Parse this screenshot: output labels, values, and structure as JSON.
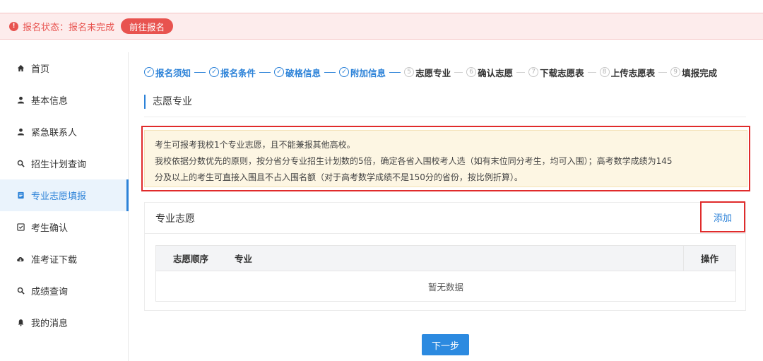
{
  "alert": {
    "icon": "exclamation-icon",
    "text": "报名状态：报名未完成",
    "button": "前往报名",
    "color": "#e8534f"
  },
  "sidebar": {
    "items": [
      {
        "label": "首页",
        "icon": "home-icon"
      },
      {
        "label": "基本信息",
        "icon": "user-icon"
      },
      {
        "label": "紧急联系人",
        "icon": "user-icon"
      },
      {
        "label": "招生计划查询",
        "icon": "search-icon"
      },
      {
        "label": "专业志愿填报",
        "icon": "form-icon",
        "active": true
      },
      {
        "label": "考生确认",
        "icon": "checkbox-icon"
      },
      {
        "label": "准考证下载",
        "icon": "cloud-download-icon"
      },
      {
        "label": "成绩查询",
        "icon": "search-icon"
      },
      {
        "label": "我的消息",
        "icon": "bell-icon"
      }
    ]
  },
  "steps": [
    {
      "num": "✓",
      "label": "报名须知",
      "done": true
    },
    {
      "num": "✓",
      "label": "报名条件",
      "done": true
    },
    {
      "num": "✓",
      "label": "破格信息",
      "done": true
    },
    {
      "num": "✓",
      "label": "附加信息",
      "done": true
    },
    {
      "num": "5",
      "label": "志愿专业",
      "done": false
    },
    {
      "num": "6",
      "label": "确认志愿",
      "done": false
    },
    {
      "num": "7",
      "label": "下载志愿表",
      "done": false
    },
    {
      "num": "8",
      "label": "上传志愿表",
      "done": false
    },
    {
      "num": "9",
      "label": "填报完成",
      "done": false
    }
  ],
  "section": {
    "title": "志愿专业"
  },
  "notice": {
    "line1": "考生可报考我校1个专业志愿，且不能兼报其他高校。",
    "line2": "我校依据分数优先的原则，按分省分专业招生计划数的5倍，确定各省入围校考人选（如有末位同分考生，均可入围）；高考数学成绩为145",
    "line3": "分及以上的考生可直接入围且不占入围名额（对于高考数学成绩不是150分的省份，按比例折算）。"
  },
  "panel": {
    "title": "专业志愿",
    "add": "添加",
    "table": {
      "headers": [
        "志愿顺序",
        "专业",
        "操作"
      ],
      "empty": "暂无数据"
    }
  },
  "next_button": "下一步",
  "colors": {
    "accent": "#2c82d8",
    "danger": "#e02b2b",
    "notice_bg": "#fdf6e3"
  }
}
